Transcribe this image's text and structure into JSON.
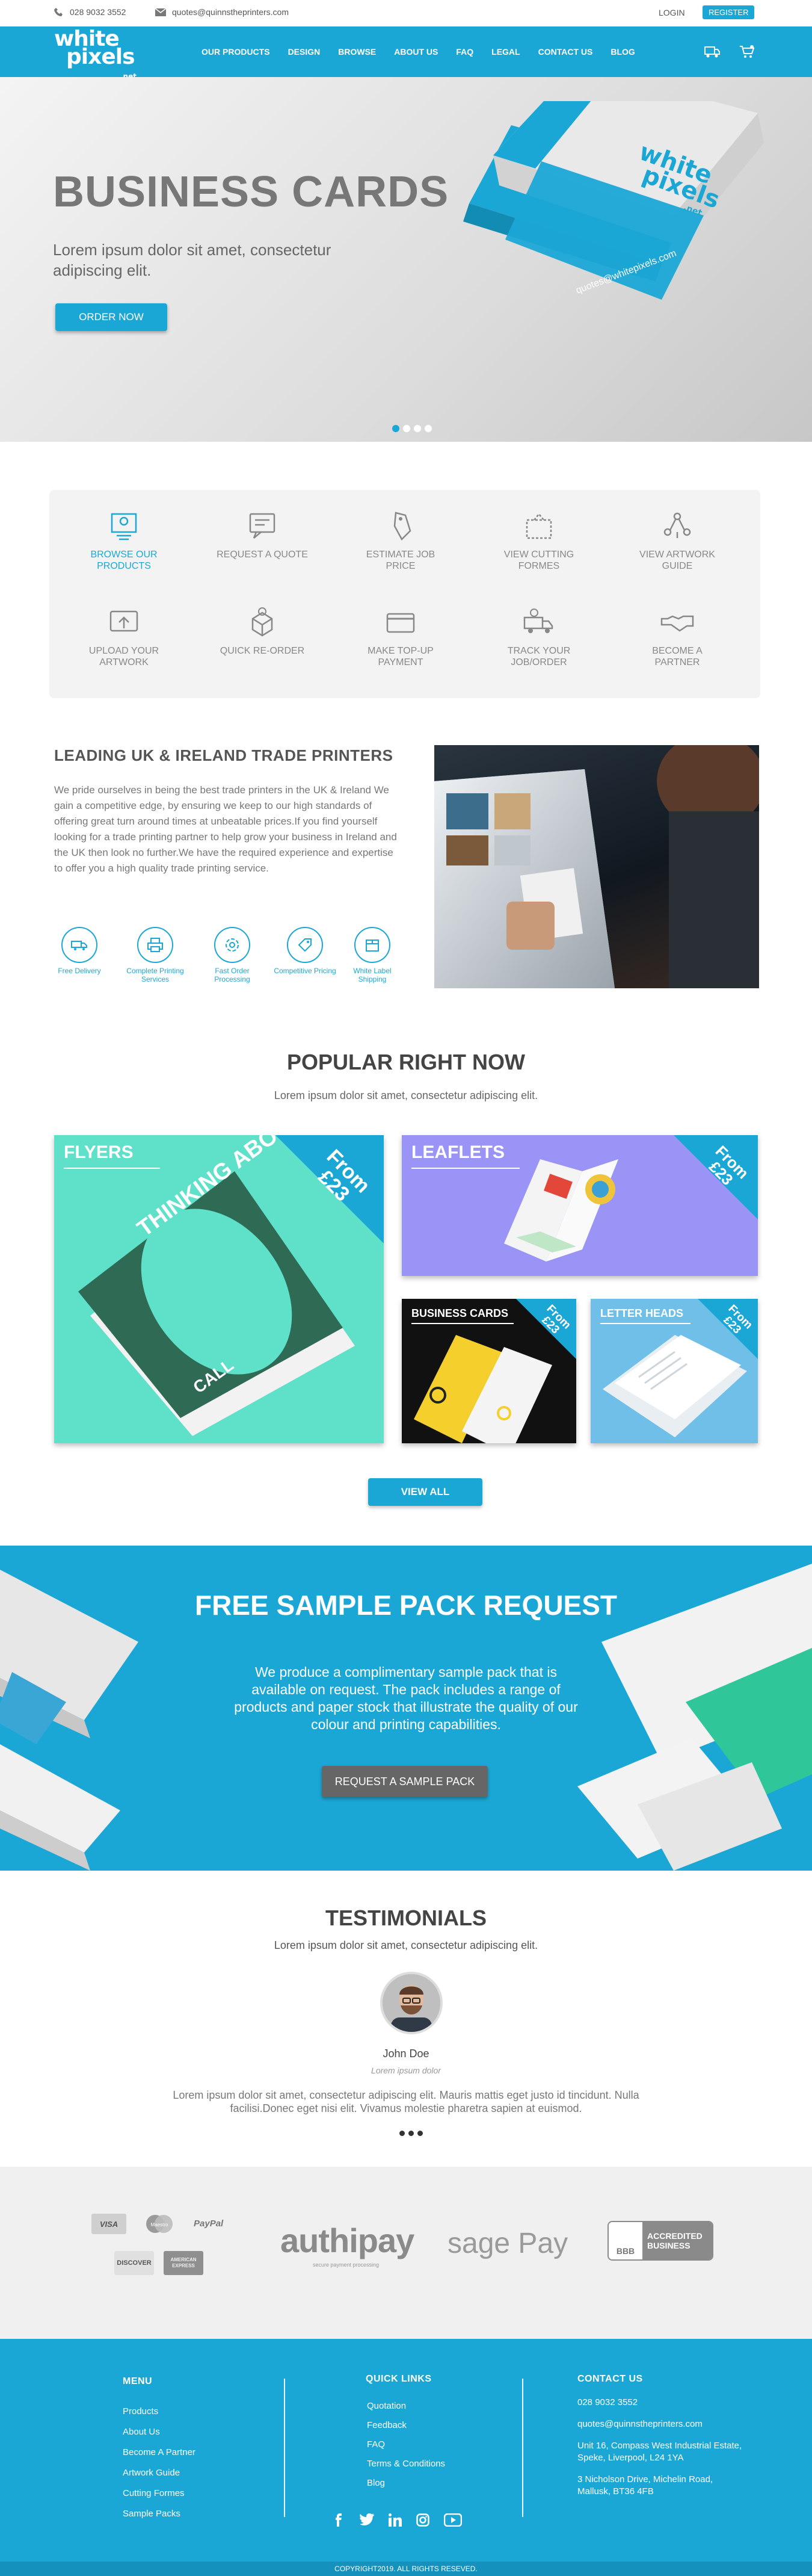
{
  "topbar": {
    "phone": "028 9032 3552",
    "email": "quotes@quinnstheprinters.com",
    "login": "LOGIN",
    "register": "REGISTER"
  },
  "brand": {
    "line1": "white",
    "line2": "pixels",
    "line3": ".net",
    "accent": "#1ba7d6"
  },
  "nav": {
    "items": [
      "OUR PRODUCTS",
      "DESIGN",
      "BROWSE",
      "ABOUT US",
      "FAQ",
      "LEGAL",
      "CONTACT US",
      "BLOG"
    ],
    "icons": [
      "quote-truck-icon",
      "cart-icon"
    ]
  },
  "hero": {
    "title": "BUSINESS CARDS",
    "subtitle": "Lorem ipsum dolor sit amet, consectetur adipiscing elit.",
    "cta": "ORDER NOW",
    "card_logo_1": "white",
    "card_logo_2": "pixels",
    "card_logo_3": ".net",
    "card_email": "quotes@whitepixels.com",
    "slides": 4,
    "active_slide": 1
  },
  "services": [
    {
      "label": "BROWSE OUR PRODUCTS",
      "icon": "browse-icon",
      "active": true
    },
    {
      "label": "REQUEST A QUOTE",
      "icon": "quote-icon"
    },
    {
      "label": "ESTIMATE JOB PRICE",
      "icon": "price-tag-icon"
    },
    {
      "label": "VIEW CUTTING FORMES",
      "icon": "cutting-icon"
    },
    {
      "label": "VIEW ARTWORK GUIDE",
      "icon": "artwork-guide-icon"
    },
    {
      "label": "UPLOAD YOUR ARTWORK",
      "icon": "upload-icon"
    },
    {
      "label": "QUICK RE-ORDER",
      "icon": "reorder-icon"
    },
    {
      "label": "MAKE TOP-UP PAYMENT",
      "icon": "card-payment-icon"
    },
    {
      "label": "TRACK YOUR JOB/ORDER",
      "icon": "truck-icon"
    },
    {
      "label": "BECOME A PARTNER",
      "icon": "handshake-icon"
    }
  ],
  "about": {
    "title": "LEADING UK & IRELAND TRADE PRINTERS",
    "body": "We pride ourselves in being the best trade printers in the UK & Ireland We gain a competitive edge, by ensuring we keep to our high standards of offering great turn around times at unbeatable prices.If you find yourself looking for a trade printing partner to help grow your business in Ireland and the UK then look no further.We have the required experience and expertise to offer you a high quality trade printing service.",
    "features": [
      "Free Delivery",
      "Complete Printing Services",
      "Fast Order Processing",
      "Competitive Pricing",
      "White Label Shipping"
    ]
  },
  "popular": {
    "title": "POPULAR RIGHT NOW",
    "subtitle": "Lorem ipsum dolor sit amet, consectetur adipiscing elit.",
    "from": "From",
    "price": "£23",
    "products": [
      "FLYERS",
      "LEAFLETS",
      "BUSINESS CARDS",
      "LETTER HEADS"
    ],
    "flyer_text": "THINKING ABOUT GUITAR LESSONS?",
    "flyer_call": "CALL",
    "view_all": "VIEW ALL"
  },
  "sample": {
    "title": "FREE SAMPLE PACK REQUEST",
    "body": "We produce a complimentary sample pack that is available on request. The pack includes a range of products and paper stock that illustrate the quality of our colour and printing capabilities.",
    "cta": "REQUEST A SAMPLE PACK"
  },
  "testimonials": {
    "title": "TESTIMONIALS",
    "subtitle": "Lorem ipsum dolor sit amet, consectetur  adipiscing elit.",
    "name": "John Doe",
    "role": "Lorem ipsum dolor",
    "quote": "Lorem ipsum dolor sit amet, consectetur adipiscing elit. Mauris mattis eget justo id tincidunt. Nulla facilisi.Donec eget nisi elit. Vivamus molestie pharetra sapien at euismod."
  },
  "payments": {
    "cards": [
      "VISA",
      "Maestro",
      "PayPal",
      "DISCOVER",
      "AMERICAN EXPRESS"
    ],
    "authipay": "authipay",
    "authipay_tag": "secure payment processing",
    "sagepay": "sage Pay",
    "bbb": "BBB",
    "bbb_text": "ACCREDITED BUSINESS"
  },
  "footer": {
    "menu_title": "MENU",
    "menu": [
      "Products",
      "About Us",
      "Become A Partner",
      "Artwork Guide",
      "Cutting Formes",
      "Sample Packs"
    ],
    "links_title": "QUICK LINKS",
    "links": [
      "Quotation",
      "Feedback",
      "FAQ",
      "Terms & Conditions",
      "Blog"
    ],
    "contact_title": "CONTACT US",
    "phone": "028 9032 3552",
    "email": "quotes@quinnstheprinters.com",
    "address1": "Unit 16, Compass West Industrial Estate, Speke, Liverpool, L24 1YA",
    "address2": "3 Nicholson Drive, Michelin Road, Mallusk, BT36 4FB",
    "social": [
      "facebook-icon",
      "twitter-icon",
      "linkedin-icon",
      "instagram-icon",
      "youtube-icon"
    ],
    "copyright": "COPYRIGHT2019. ALL RIGHTS RESEVED."
  }
}
